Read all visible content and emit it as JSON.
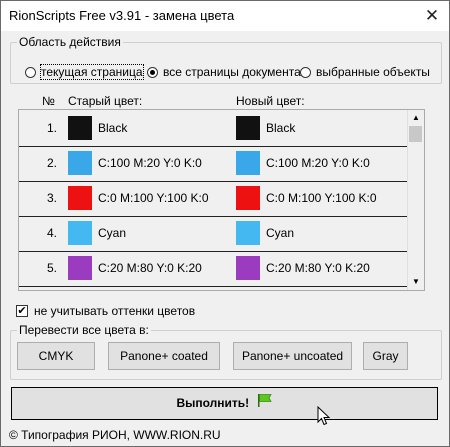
{
  "window": {
    "title": "RionScripts Free v3.91 - замена цвета",
    "close_glyph": "✕"
  },
  "scope": {
    "legend": "Область действия",
    "options": [
      {
        "label": "текущая страница",
        "checked": false
      },
      {
        "label": "все страницы документа",
        "checked": true
      },
      {
        "label": "выбранные объекты",
        "checked": false
      }
    ]
  },
  "list": {
    "headers": {
      "num": "№",
      "old": "Старый цвет:",
      "new": "Новый цвет:"
    },
    "rows": [
      {
        "num": "1.",
        "old_color": "#111111",
        "old_text": "Black",
        "new_color": "#111111",
        "new_text": "Black"
      },
      {
        "num": "2.",
        "old_color": "#3aa8e8",
        "old_text": "C:100 M:20 Y:0 K:0",
        "new_color": "#3aa8e8",
        "new_text": "C:100 M:20 Y:0 K:0"
      },
      {
        "num": "3.",
        "old_color": "#ee1111",
        "old_text": "C:0 M:100 Y:100 K:0",
        "new_color": "#ee1111",
        "new_text": "C:0 M:100 Y:100 K:0"
      },
      {
        "num": "4.",
        "old_color": "#44b8f0",
        "old_text": "Cyan",
        "new_color": "#44b8f0",
        "new_text": "Cyan"
      },
      {
        "num": "5.",
        "old_color": "#9b3bc0",
        "old_text": "C:20 M:80 Y:0 K:20",
        "new_color": "#9b3bc0",
        "new_text": "C:20 M:80 Y:0 K:20"
      }
    ]
  },
  "ignore_shades": {
    "label": "не учитывать оттенки цветов",
    "checked": true,
    "mark": "✔"
  },
  "convert": {
    "legend": "Перевести все цвета в:",
    "buttons": {
      "cmyk": "CMYK",
      "coated": "Panone+ coated",
      "uncoated": "Panone+ uncoated",
      "gray": "Gray"
    }
  },
  "run": {
    "label": "Выполнить!"
  },
  "footer": {
    "text": "© Типография РИОН,  WWW.RION.RU"
  },
  "colors": {
    "flag": "#5ac81e"
  }
}
